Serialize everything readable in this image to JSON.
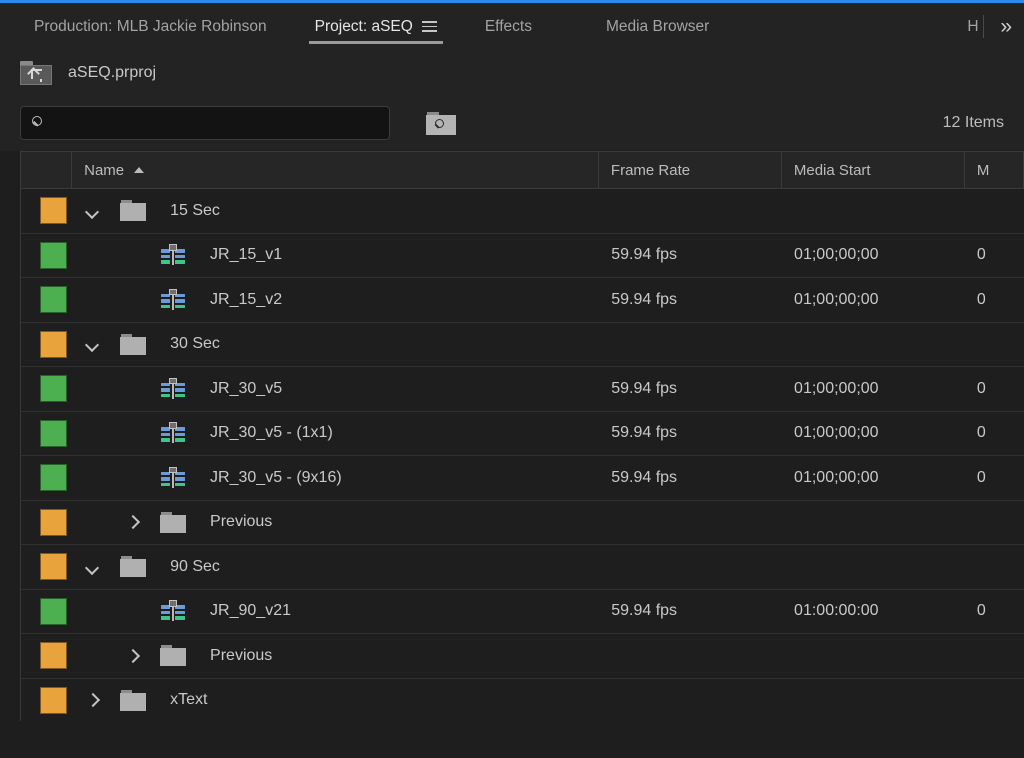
{
  "window": {
    "accent_color": "#2d8ceb"
  },
  "tabs": [
    {
      "label": "Production: MLB Jackie Robinson",
      "active": false
    },
    {
      "label": "Project: aSEQ",
      "active": true,
      "menu_icon": "hamburger-menu-icon"
    },
    {
      "label": "Effects",
      "active": false
    },
    {
      "label": "Media Browser",
      "active": false
    }
  ],
  "tab_clipped_label": "H",
  "overflow_label": "»",
  "breadcrumb": {
    "icon": "navigate-up-folder-icon",
    "label": "aSEQ.prproj"
  },
  "search": {
    "icon": "search-icon",
    "value": "",
    "placeholder": "",
    "find_bin_icon": "find-in-bin-icon"
  },
  "item_count": "12 Items",
  "columns": [
    {
      "key": "label",
      "label": ""
    },
    {
      "key": "name",
      "label": "Name",
      "sort": "ascending"
    },
    {
      "key": "fps",
      "label": "Frame Rate"
    },
    {
      "key": "start",
      "label": "Media Start"
    },
    {
      "key": "end",
      "label": "M"
    }
  ],
  "colors": {
    "bin_label": "#e8a33d",
    "sequence_label": "#4caf50"
  },
  "rows": [
    {
      "name": "15 Sec",
      "type": "bin",
      "label_color": "#e8a33d",
      "indent": 1,
      "disclosure": "down",
      "fps": "",
      "start": "",
      "end": ""
    },
    {
      "name": "JR_15_v1",
      "type": "sequence",
      "label_color": "#4caf50",
      "indent": 2,
      "disclosure": "none",
      "fps": "59.94 fps",
      "start": "01;00;00;00",
      "end": "0"
    },
    {
      "name": "JR_15_v2",
      "type": "sequence",
      "label_color": "#4caf50",
      "indent": 2,
      "disclosure": "none",
      "fps": "59.94 fps",
      "start": "01;00;00;00",
      "end": "0"
    },
    {
      "name": "30 Sec",
      "type": "bin",
      "label_color": "#e8a33d",
      "indent": 1,
      "disclosure": "down",
      "fps": "",
      "start": "",
      "end": ""
    },
    {
      "name": "JR_30_v5",
      "type": "sequence",
      "label_color": "#4caf50",
      "indent": 2,
      "disclosure": "none",
      "fps": "59.94 fps",
      "start": "01;00;00;00",
      "end": "0"
    },
    {
      "name": "JR_30_v5 - (1x1)",
      "type": "sequence",
      "label_color": "#4caf50",
      "indent": 2,
      "disclosure": "none",
      "fps": "59.94 fps",
      "start": "01;00;00;00",
      "end": "0"
    },
    {
      "name": "JR_30_v5 - (9x16)",
      "type": "sequence",
      "label_color": "#4caf50",
      "indent": 2,
      "disclosure": "none",
      "fps": "59.94 fps",
      "start": "01;00;00;00",
      "end": "0"
    },
    {
      "name": "Previous",
      "type": "bin",
      "label_color": "#e8a33d",
      "indent": 2,
      "disclosure": "right",
      "fps": "",
      "start": "",
      "end": ""
    },
    {
      "name": "90 Sec",
      "type": "bin",
      "label_color": "#e8a33d",
      "indent": 1,
      "disclosure": "down",
      "fps": "",
      "start": "",
      "end": ""
    },
    {
      "name": "JR_90_v21",
      "type": "sequence",
      "label_color": "#4caf50",
      "indent": 2,
      "disclosure": "none",
      "fps": "59.94 fps",
      "start": "01:00:00:00",
      "end": "0"
    },
    {
      "name": "Previous",
      "type": "bin",
      "label_color": "#e8a33d",
      "indent": 2,
      "disclosure": "right",
      "fps": "",
      "start": "",
      "end": ""
    },
    {
      "name": "xText",
      "type": "bin",
      "label_color": "#e8a33d",
      "indent": 1,
      "disclosure": "right",
      "fps": "",
      "start": "",
      "end": ""
    }
  ]
}
